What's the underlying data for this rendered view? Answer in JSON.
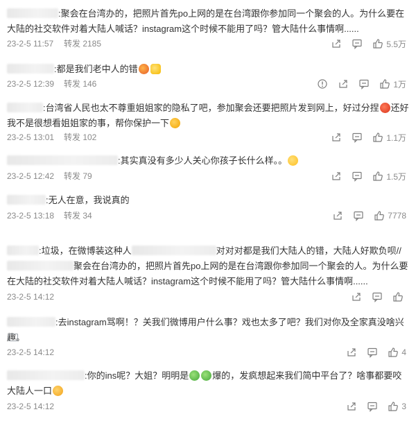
{
  "comments": [
    {
      "sep": ":",
      "text": "聚会在台湾办的，把照片首先po上网的是在台湾跟你参加同一个聚会的人。为什么要在大陆的社交软件对着大陆人喊话？instagram这个时候不能用了吗？管大陆什么事情啊......",
      "time": "23-2-5 11:57",
      "forward": "转发 2185",
      "likes": "5.5万"
    },
    {
      "sep": ":",
      "text": "都是我们老中人的错",
      "time": "23-2-5 12:39",
      "forward": "转发 146",
      "likes": "1万"
    },
    {
      "sep": ":",
      "text_a": "台湾省人民也太不尊重姐姐家的隐私了吧，参加聚会还要把照片发到网上，好过分捏",
      "text_b": "还好我不是很想看姐姐家的事，帮你保护一下",
      "time": "23-2-5 13:01",
      "forward": "转发 102",
      "likes": "1.1万"
    },
    {
      "sep": ":",
      "text": "其实真没有多少人关心你孩子长什么样。。",
      "time": "23-2-5 12:42",
      "forward": "转发 79",
      "likes": "1.5万"
    },
    {
      "sep": ":",
      "text": "无人在意，我说真的",
      "time": "23-2-5 13:18",
      "forward": "转发 34",
      "likes": "7778"
    },
    {
      "part1": ":垃圾，在微博装这种人",
      "part2": "对对对都是我们大陆人的错，大陆人好欺负呗//",
      "part3": "聚会在台湾办的，把照片首先po上网的是在台湾跟你参加同一个聚会的人。为什么要在大陆的社交软件对着大陆人喊话？instagram这个时候不能用了吗？管大陆什么事情啊......",
      "time": "23-2-5 14:12",
      "likes": ""
    },
    {
      "sep": ":",
      "text": "去instagram骂啊！？关我们微博用户什么事？戏也太多了吧？我们对你及全家真没啥兴趣。",
      "time": "23-2-5 14:12",
      "likes": "4"
    },
    {
      "sep": ":",
      "text_a": "你的ins呢？大姐？明明是",
      "text_b": "爆的，发疯想起来我们简中平台了？啥事都要咬大陆人一口",
      "time": "23-2-5 14:12",
      "likes": "3"
    }
  ],
  "icons": {
    "share": "share-icon",
    "comment": "comment-icon",
    "like": "thumbs-up-icon",
    "report": "report-icon"
  }
}
